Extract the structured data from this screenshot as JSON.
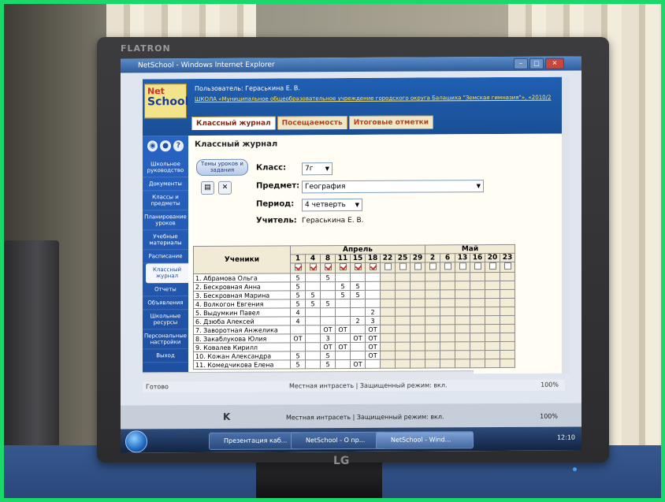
{
  "monitor": {
    "brand": "FLATRON",
    "logo": "LG"
  },
  "browser": {
    "title": "NetSchool - Windows Internet Explorer",
    "status_left": "Готово",
    "status_zone": "Местная интрасеть | Защищенный режим: вкл.",
    "zoom": "100%"
  },
  "app": {
    "logo_net": "Net",
    "logo_school": "School",
    "user": "Пользователь: Гераськина Е. В.",
    "school_link": "ШКОЛА «Муниципальное общеобразовательное учреждение городского округа Балашиха \"Земская гимназия\"», «2010/2",
    "tabs": [
      "Классный журнал",
      "Посещаемость",
      "Итоговые отметки"
    ]
  },
  "sidebar": {
    "items": [
      "Школьное руководство",
      "Документы",
      "Классы и предметы",
      "Планирование уроков",
      "Учебные материалы",
      "Расписание",
      "Классный журнал",
      "Отчеты",
      "Объявления",
      "Школьные ресурсы",
      "Персональные настройки",
      "Выход"
    ]
  },
  "journal": {
    "title": "Классный журнал",
    "topics_button": "Темы уроков и задания",
    "class_label": "Класс:",
    "class_value": "7г",
    "subject_label": "Предмет:",
    "subject_value": "География",
    "period_label": "Период:",
    "period_value": "4 четверть",
    "teacher_label": "Учитель:",
    "teacher_value": "Гераськина Е. В.",
    "students_header": "Ученики",
    "month_april": "Апрель",
    "month_may": "Май",
    "april_days": [
      "1",
      "4",
      "8",
      "11",
      "15",
      "18",
      "22",
      "25",
      "29"
    ],
    "may_days": [
      "2",
      "6",
      "13",
      "16",
      "20",
      "23"
    ],
    "rows": [
      {
        "name": "1. Абрамова Ольга",
        "grades": [
          "5",
          "",
          "5",
          "",
          "",
          "",
          "",
          "",
          ""
        ]
      },
      {
        "name": "2. Бескровная Анна",
        "grades": [
          "5",
          "",
          "",
          "5",
          "5",
          "",
          "",
          "",
          ""
        ]
      },
      {
        "name": "3. Бескровная Марина",
        "grades": [
          "5",
          "5",
          "",
          "5",
          "5",
          "",
          "",
          "",
          ""
        ]
      },
      {
        "name": "4. Волкогон Евгения",
        "grades": [
          "5",
          "5",
          "5",
          "",
          "",
          "",
          "",
          "",
          ""
        ]
      },
      {
        "name": "5. Выдумкин Павел",
        "grades": [
          "4",
          "",
          "",
          "",
          "",
          "2",
          "",
          "",
          ""
        ]
      },
      {
        "name": "6. Дзюба Алексей",
        "grades": [
          "4",
          "",
          "",
          "",
          "2",
          "3",
          "",
          "",
          ""
        ]
      },
      {
        "name": "7. Заворотная Анжелика",
        "grades": [
          "",
          "",
          "ОТ",
          "ОТ",
          "",
          "ОТ",
          "",
          "",
          ""
        ]
      },
      {
        "name": "8. Закаблукова Юлия",
        "grades": [
          "ОТ",
          "",
          "3",
          "",
          "ОТ",
          "ОТ",
          "",
          "",
          ""
        ]
      },
      {
        "name": "9. Ковалев Кирилл",
        "grades": [
          "",
          "",
          "ОТ",
          "ОТ",
          "",
          "ОТ",
          "",
          "",
          ""
        ]
      },
      {
        "name": "10. Кожан Александра",
        "grades": [
          "5",
          "",
          "5",
          "",
          "",
          "ОТ",
          "",
          "",
          ""
        ]
      },
      {
        "name": "11. Комедчикова Елена",
        "grades": [
          "5",
          "",
          "5",
          "",
          "ОТ",
          "",
          "",
          "",
          ""
        ]
      }
    ]
  },
  "taskbar": {
    "ie_bar_letter": "K",
    "tasks": [
      "Презентация каб...",
      "NetSchool - О пр...",
      "NetSchool - Wind..."
    ],
    "clock": "12:10"
  }
}
